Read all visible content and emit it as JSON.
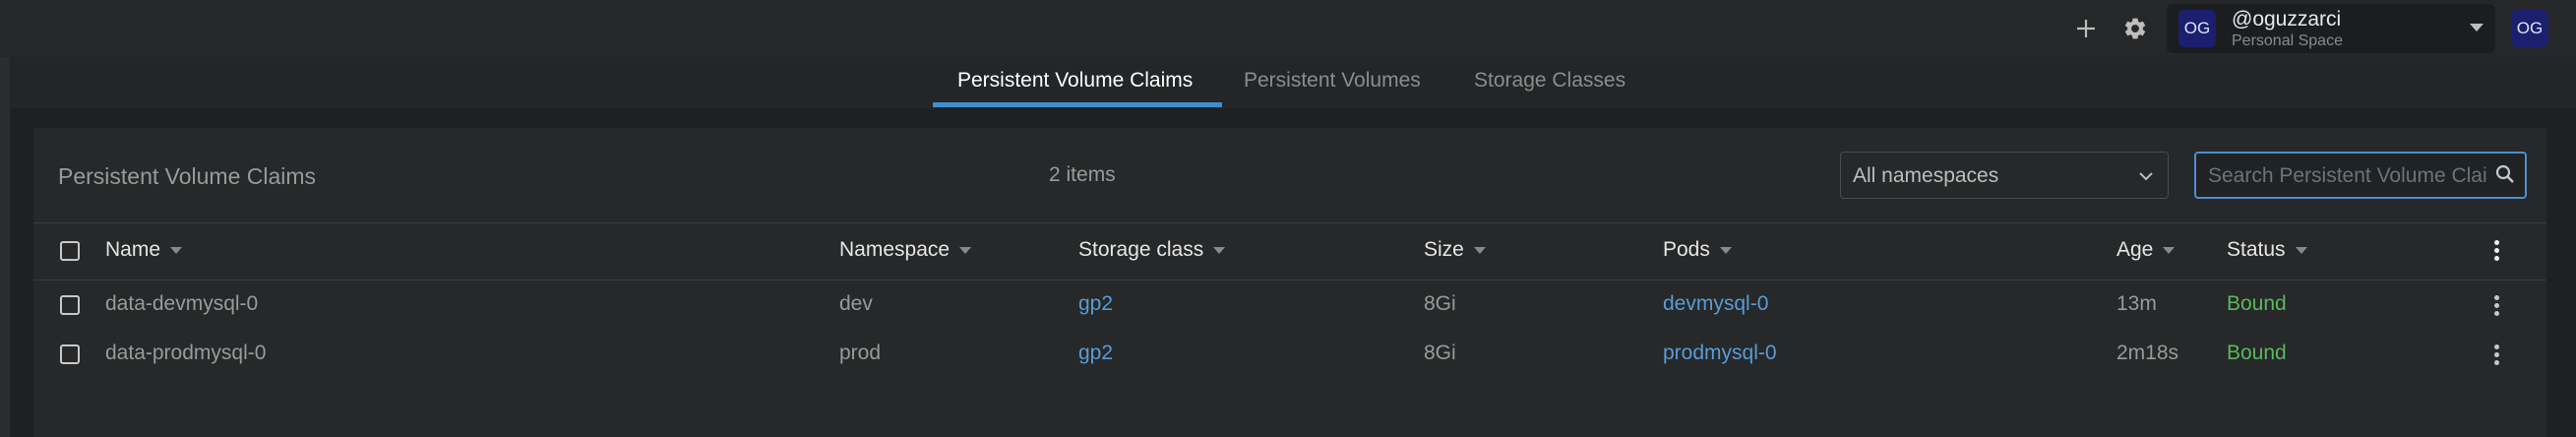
{
  "topbar": {
    "add_icon": "plus-icon",
    "settings_icon": "gear-icon",
    "account": {
      "initials": "OG",
      "name": "@oguzzarci",
      "space": "Personal Space"
    },
    "user_initials": "OG"
  },
  "tabs": [
    {
      "label": "Persistent Volume Claims",
      "active": true
    },
    {
      "label": "Persistent Volumes",
      "active": false
    },
    {
      "label": "Storage Classes",
      "active": false
    }
  ],
  "panel": {
    "title": "Persistent Volume Claims",
    "items_count": "2 items",
    "namespace_filter": "All namespaces",
    "search_placeholder": "Search Persistent Volume Claims..."
  },
  "table": {
    "columns": [
      "Name",
      "Namespace",
      "Storage class",
      "Size",
      "Pods",
      "Age",
      "Status"
    ],
    "rows": [
      {
        "name": "data-devmysql-0",
        "namespace": "dev",
        "storage_class": "gp2",
        "size": "8Gi",
        "pods": "devmysql-0",
        "age": "13m",
        "status": "Bound"
      },
      {
        "name": "data-prodmysql-0",
        "namespace": "prod",
        "storage_class": "gp2",
        "size": "8Gi",
        "pods": "prodmysql-0",
        "age": "2m18s",
        "status": "Bound"
      }
    ]
  },
  "colors": {
    "accent": "#3d90ce",
    "link": "#5a9bd6",
    "status_bound": "#5bb85d",
    "background": "#1e2124"
  }
}
